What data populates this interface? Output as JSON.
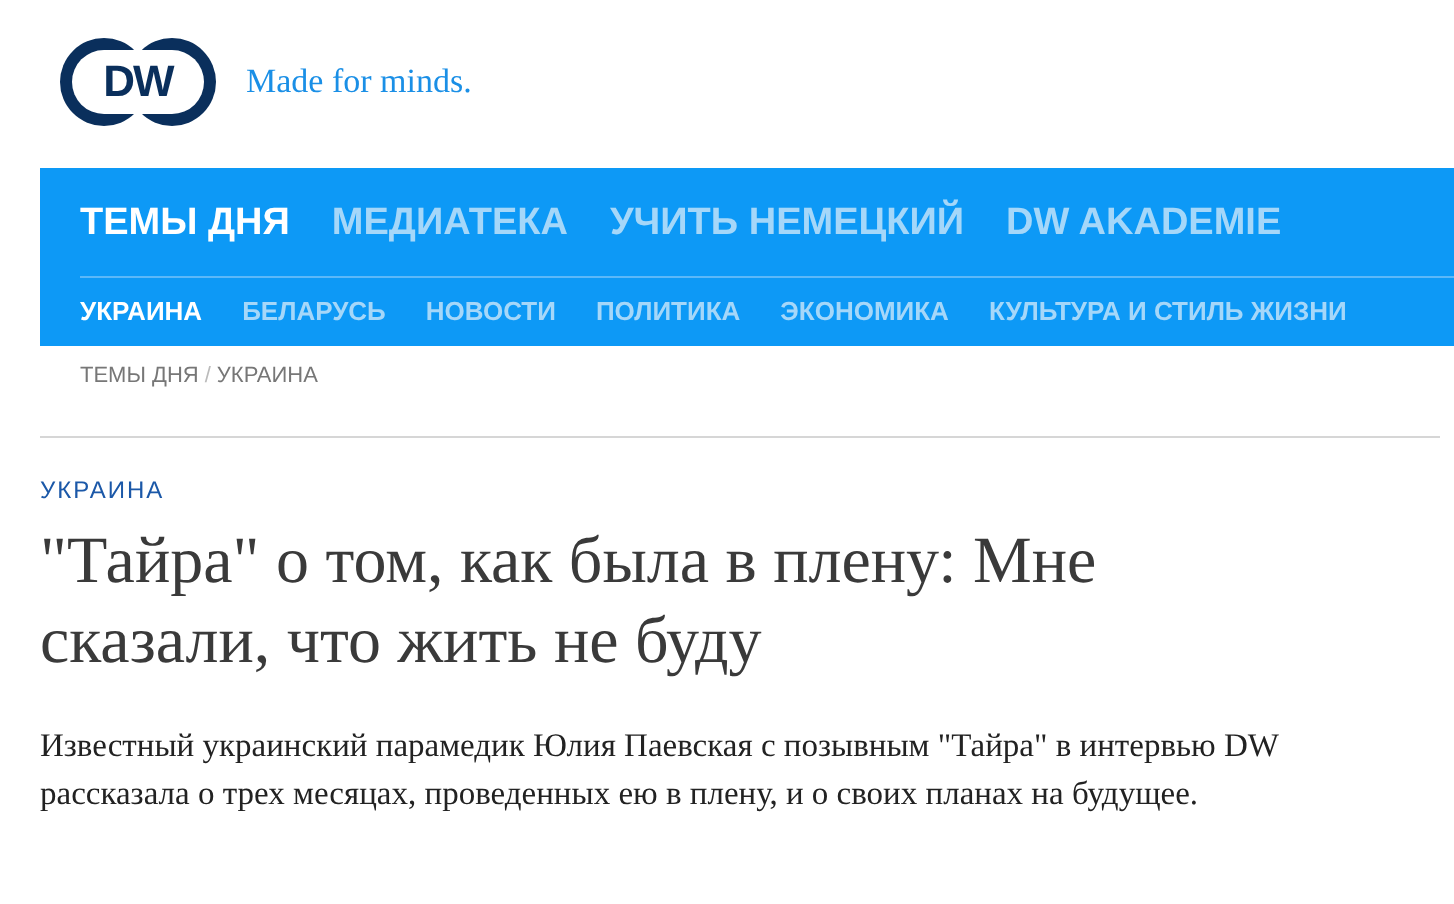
{
  "logo": {
    "text": "DW",
    "tagline": "Made for minds."
  },
  "main_nav": [
    {
      "label": "ТЕМЫ ДНЯ",
      "selected": true
    },
    {
      "label": "МЕДИАТЕКА",
      "selected": false
    },
    {
      "label": "УЧИТЬ НЕМЕЦКИЙ",
      "selected": false
    },
    {
      "label": "DW AKADEMIE",
      "selected": false
    }
  ],
  "sub_nav": [
    {
      "label": "УКРАИНА",
      "selected": true
    },
    {
      "label": "БЕЛАРУСЬ",
      "selected": false
    },
    {
      "label": "НОВОСТИ",
      "selected": false
    },
    {
      "label": "ПОЛИТИКА",
      "selected": false
    },
    {
      "label": "ЭКОНОМИКА",
      "selected": false
    },
    {
      "label": "КУЛЬТУРА И СТИЛЬ ЖИЗНИ",
      "selected": false
    }
  ],
  "breadcrumb": [
    "ТЕМЫ ДНЯ",
    "УКРАИНА"
  ],
  "breadcrumb_separator": "/",
  "article": {
    "category": "УКРАИНА",
    "headline": "\"Тайра\" о том, как была в плену: Мне сказали, что жить не буду",
    "lead": "Известный украинский парамедик Юлия Паевская с позывным \"Тайра\" в интервью DW рассказала о трех месяцах, проведенных ею в плену, и о своих планах на будущее."
  }
}
